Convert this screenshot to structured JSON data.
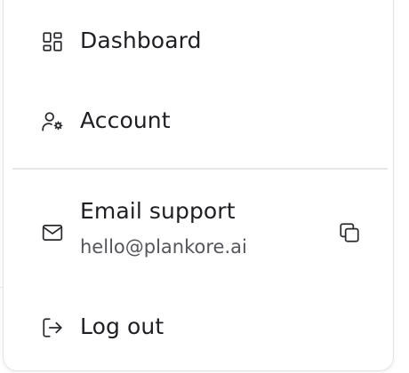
{
  "menu": {
    "items": [
      {
        "label": "Dashboard",
        "icon": "dashboard-icon"
      },
      {
        "label": "Account",
        "icon": "user-settings-icon"
      }
    ],
    "support": {
      "label": "Email support",
      "email": "hello@plankore.ai",
      "icon": "mail-icon",
      "copy_icon": "copy-icon"
    },
    "logout": {
      "label": "Log out",
      "icon": "log-out-icon"
    }
  },
  "colors": {
    "text": "#1f1f23",
    "subtext": "#55555c",
    "border": "#e4e4e7",
    "divider": "#e6e6e9"
  }
}
